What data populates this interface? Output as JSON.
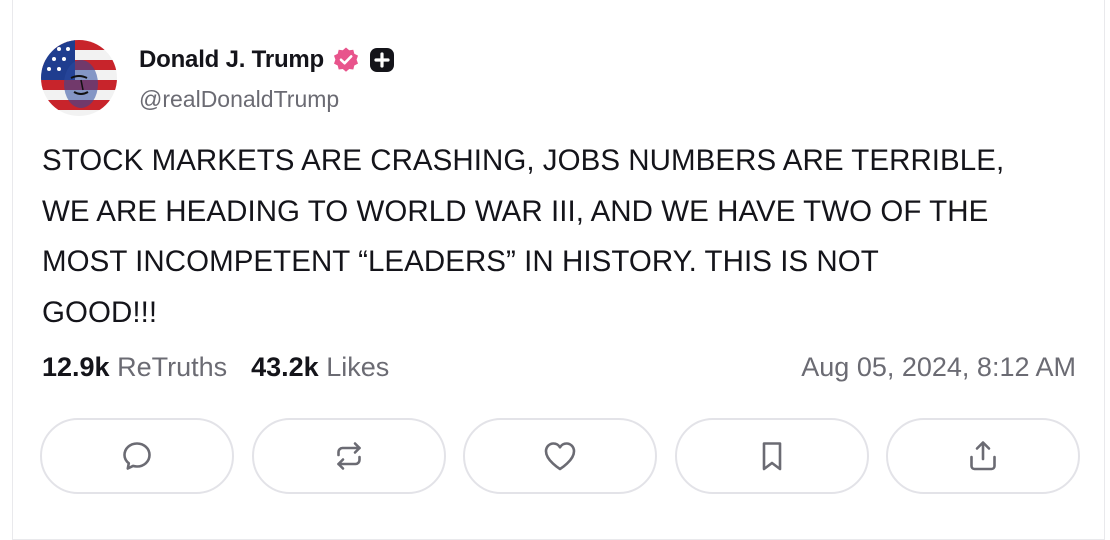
{
  "post": {
    "author": {
      "display_name": "Donald J. Trump",
      "handle": "@realDonaldTrump",
      "verified": true,
      "badges": [
        "verified-badge-icon",
        "plus-badge-icon"
      ]
    },
    "text": "STOCK MARKETS ARE CRASHING, JOBS NUMBERS ARE TERRIBLE,\nWE ARE HEADING TO WORLD WAR III, AND WE HAVE TWO OF THE\nMOST INCOMPETENT “LEADERS” IN HISTORY. THIS IS NOT\nGOOD!!!",
    "stats": {
      "retruths_count": "12.9k",
      "retruths_label": "ReTruths",
      "likes_count": "43.2k",
      "likes_label": "Likes"
    },
    "timestamp": "Aug 05, 2024, 8:12 AM"
  },
  "actions": [
    {
      "name": "reply",
      "icon": "comment-icon"
    },
    {
      "name": "retruth",
      "icon": "repost-icon"
    },
    {
      "name": "like",
      "icon": "heart-icon"
    },
    {
      "name": "bookmark",
      "icon": "bookmark-icon"
    },
    {
      "name": "share",
      "icon": "share-icon"
    }
  ],
  "colors": {
    "text_primary": "#14141a",
    "text_secondary": "#6b6b73",
    "verified_badge": "#e8548c",
    "border": "#e3e3e8",
    "icon": "#6b6b73"
  }
}
